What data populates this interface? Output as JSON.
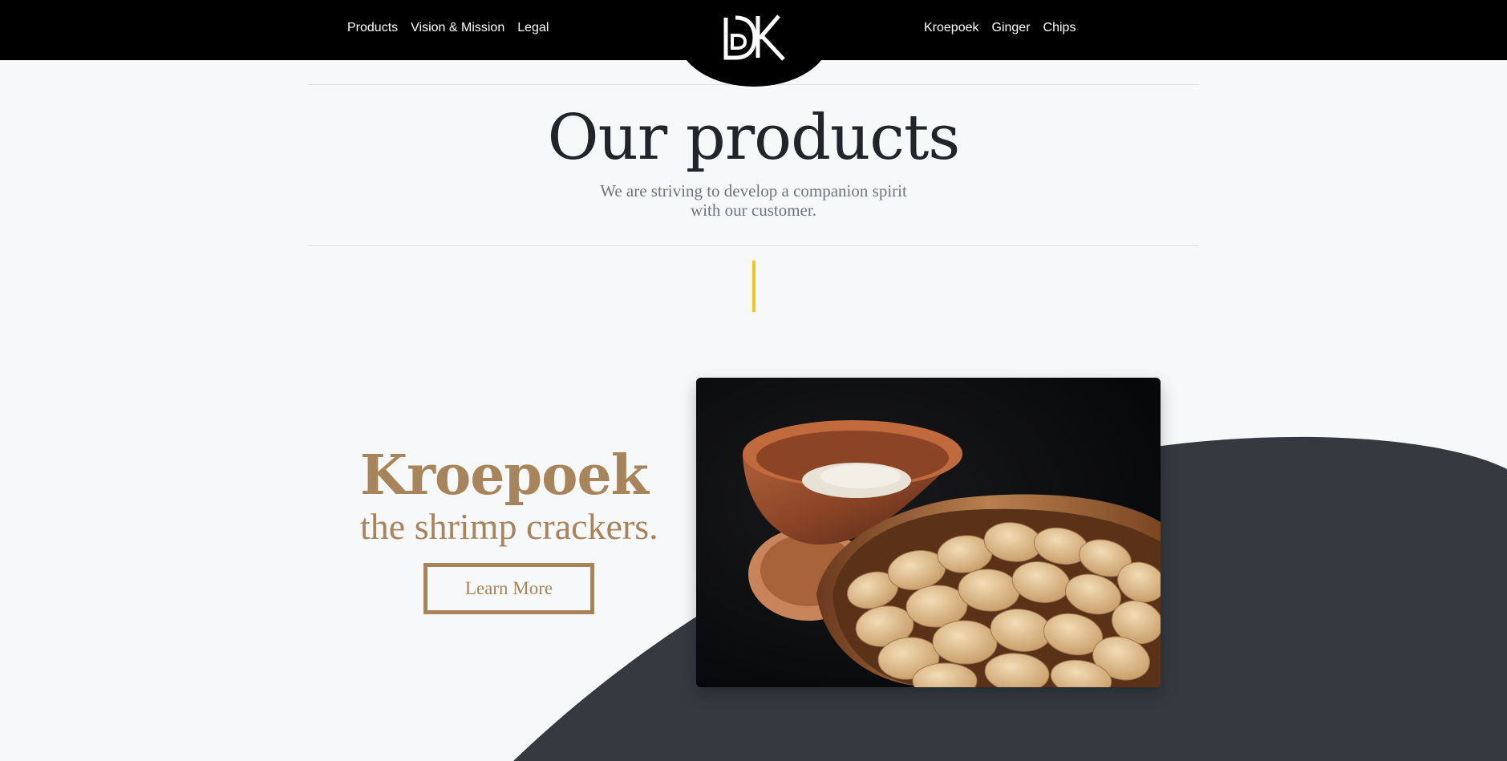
{
  "nav": {
    "left": [
      {
        "label": "Products"
      },
      {
        "label": "Vision & Mission"
      },
      {
        "label": "Legal"
      }
    ],
    "right": [
      {
        "label": "Kroepoek"
      },
      {
        "label": "Ginger"
      },
      {
        "label": "Chips"
      }
    ],
    "logo_text": "DK"
  },
  "heading": {
    "title": "Our products",
    "subtitle": "We are striving to develop a companion spirit with our customer."
  },
  "product": {
    "name": "Kroepoek",
    "tagline": "the shrimp crackers.",
    "button_label": "Learn More",
    "image_icon": "shrimp-crackers-bowl-photo"
  },
  "colors": {
    "navbar": "#000000",
    "page_background": "#f7f8fa",
    "accent_gold": "#a8845a",
    "accent_yellow": "#f5c518",
    "dark_wave": "#343a40",
    "title_text": "#212529",
    "muted_text": "#6c757d"
  }
}
